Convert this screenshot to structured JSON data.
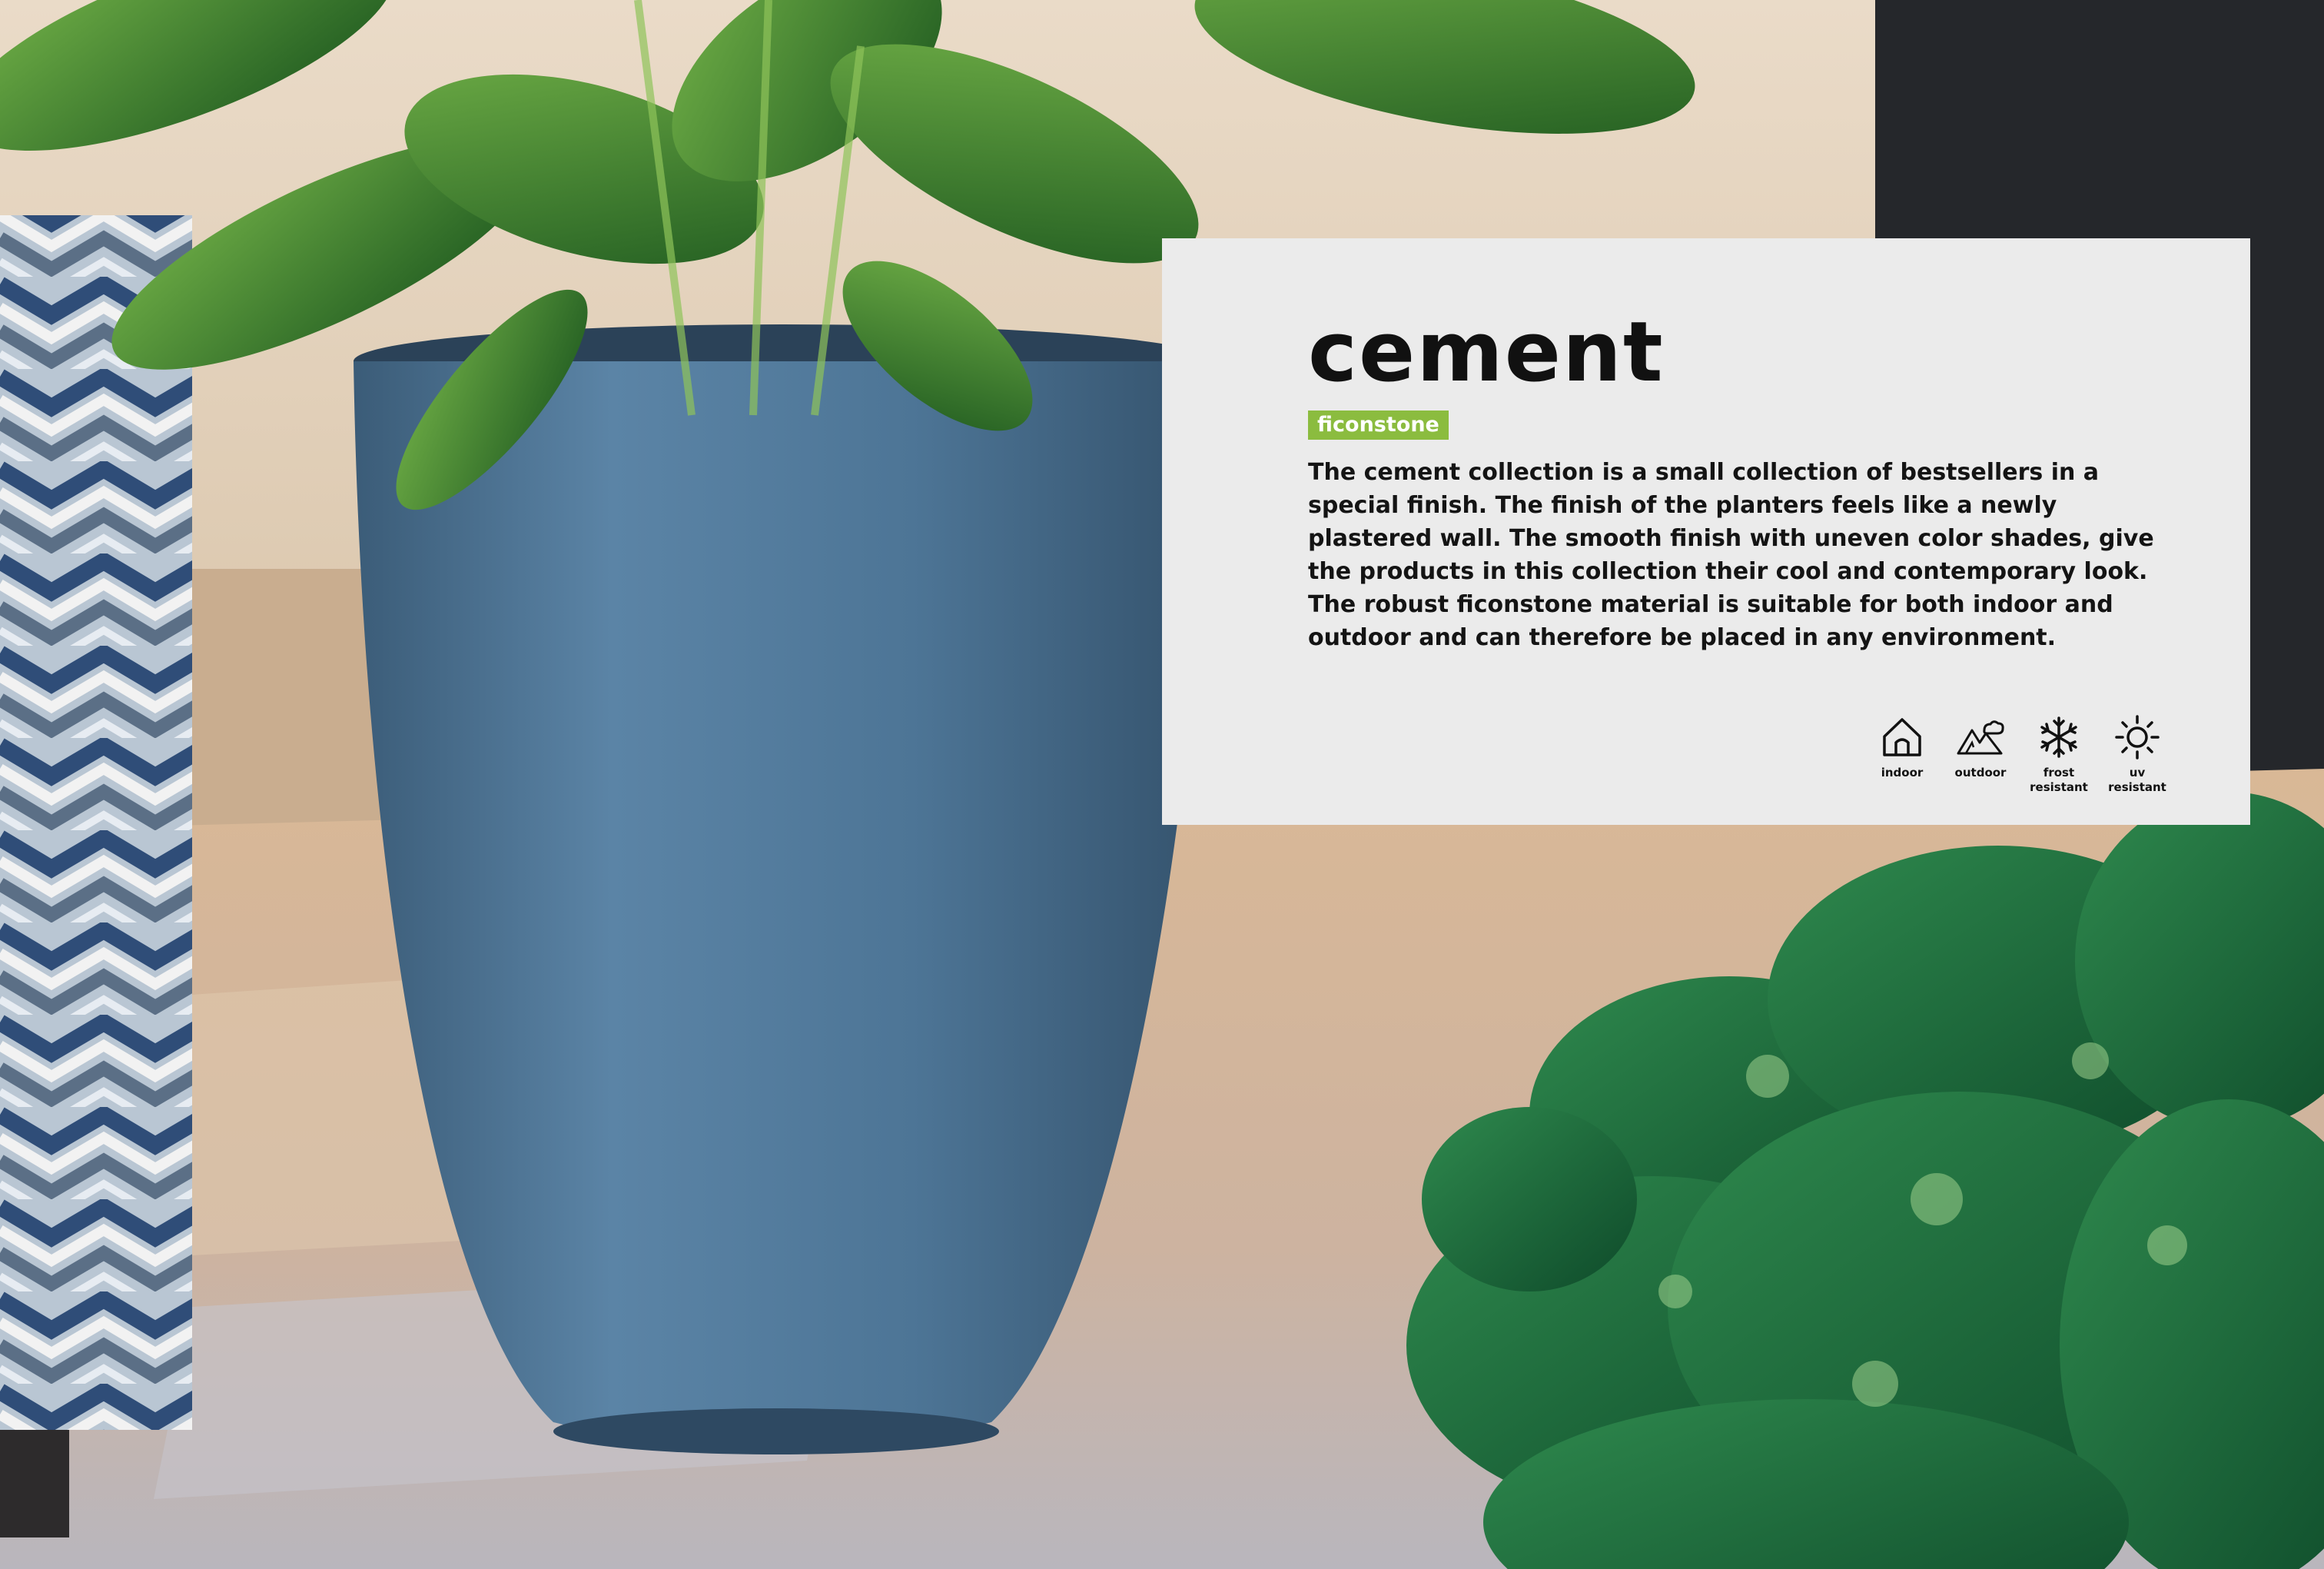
{
  "product": {
    "title": "cement",
    "material": "ficonstone",
    "description": "The cement collection is a small collection of bestsellers in a special finish. The finish of the planters feels like a newly plastered wall. The smooth finish with uneven color shades, give the products in this collection their cool and contemporary look. The robust ficonstone material is suitable for both indoor and outdoor and can therefore be placed in any environment."
  },
  "features": [
    {
      "icon": "house-icon",
      "label": "indoor"
    },
    {
      "icon": "mountain-cloud-icon",
      "label": "outdoor"
    },
    {
      "icon": "snowflake-icon",
      "label": "frost resistant"
    },
    {
      "icon": "sun-icon",
      "label": "uv resistant"
    }
  ],
  "colors": {
    "card_background": "#ebebeb",
    "badge_green": "#8bbc3f",
    "planter_blue": "#4d7596"
  }
}
